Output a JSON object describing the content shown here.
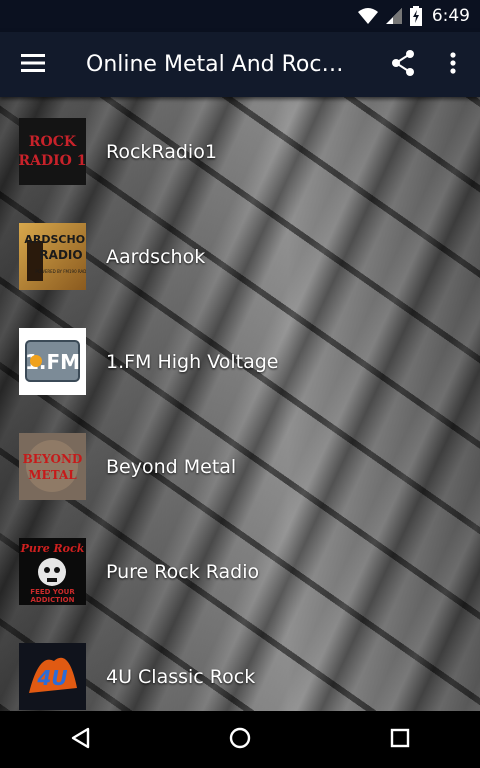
{
  "status_bar": {
    "time": "6:49"
  },
  "app_bar": {
    "title": "Online Metal And Rock…"
  },
  "stations": [
    {
      "name": "RockRadio1",
      "logo_text": "ROCK RADIO 1"
    },
    {
      "name": "Aardschok",
      "logo_text": "AARDSCHOK RADIO",
      "logo_subtext": "POWERED BY FM190 RADIO"
    },
    {
      "name": "1.FM High Voltage",
      "logo_text": "1.FM"
    },
    {
      "name": "Beyond Metal",
      "logo_text": "BEYOND METAL"
    },
    {
      "name": "Pure Rock Radio",
      "logo_text": "Pure Rock",
      "logo_subtext": "FEED YOUR ADDICTION"
    },
    {
      "name": "4U Classic Rock",
      "logo_text": "4U"
    }
  ],
  "colors": {
    "app_bar": "#121a2b",
    "status_bar": "#0b1120"
  },
  "icons": [
    "wifi-icon",
    "cellular-signal-icon",
    "battery-charging-icon",
    "menu-icon",
    "share-icon",
    "more-vert-icon",
    "back-icon",
    "home-icon",
    "recents-icon"
  ]
}
